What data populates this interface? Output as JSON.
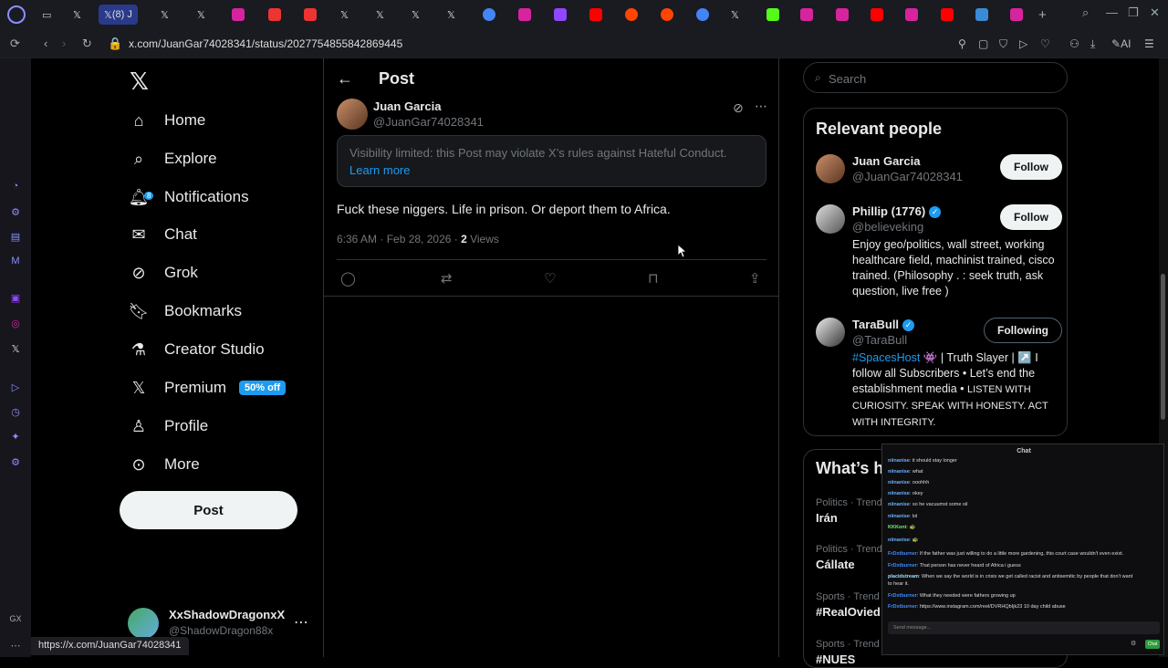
{
  "browser": {
    "url": "x.com/JuanGar74028341/status/2027754855842869445",
    "active_tab_label": "(8) J",
    "status_url": "https://x.com/JuanGar74028341",
    "ai_label": "AI",
    "rail_bottom_label": "GX"
  },
  "sidenav": {
    "items": [
      {
        "label": "Home",
        "icon": "home-icon"
      },
      {
        "label": "Explore",
        "icon": "search-icon"
      },
      {
        "label": "Notifications",
        "icon": "bell-icon"
      },
      {
        "label": "Chat",
        "icon": "mail-icon"
      },
      {
        "label": "Grok",
        "icon": "grok-icon"
      },
      {
        "label": "Bookmarks",
        "icon": "bookmark-icon"
      },
      {
        "label": "Creator Studio",
        "icon": "flask-icon"
      },
      {
        "label": "Premium",
        "icon": "x-icon"
      },
      {
        "label": "Profile",
        "icon": "person-icon"
      },
      {
        "label": "More",
        "icon": "more-circle-icon"
      }
    ],
    "notif_count": "8",
    "premium_badge": "50% off",
    "post_label": "Post",
    "account": {
      "name": "XxShadowDragonxX",
      "handle": "@ShadowDragon88x"
    }
  },
  "main": {
    "title": "Post",
    "author": {
      "name": "Juan Garcia",
      "handle": "@JuanGar74028341"
    },
    "notice": "Visibility limited: this Post may violate X’s rules against Hateful Conduct.",
    "learn_more": "Learn more",
    "tweet_text": "Fuck these niggers. Life in prison. Or deport  them to Africa.",
    "timestamp": "6:36 AM · Feb 28, 2026 · ",
    "views_count": "2",
    "views_label": " Views"
  },
  "right": {
    "search_placeholder": "Search",
    "relevant_title": "Relevant people",
    "people": [
      {
        "name": "Juan Garcia",
        "handle": "@JuanGar74028341",
        "button": "Follow",
        "bio": ""
      },
      {
        "name": "Phillip (1776)",
        "handle": "@believeking",
        "button": "Follow",
        "bio": "Enjoy geo/politics, wall street, working healthcare field, machinist trained, cisco trained. (Philosophy . : seek truth, ask question, live free )"
      },
      {
        "name": "TaraBull",
        "handle": "@TaraBull",
        "button": "Following",
        "bio_tag": "#SpacesHost",
        "bio_rest": " 👾 | Truth Slayer | ↗️ I follow all Subscribers • Let’s end the establishment media • ",
        "bio_caps": "LISTEN WITH CURIOSITY. SPEAK WITH HONESTY. ACT WITH INTEGRITY."
      }
    ],
    "trends_title": "What’s ha",
    "trends": [
      {
        "meta": "Politics · Trend",
        "name": "Irán"
      },
      {
        "meta": "Politics · Trend",
        "name": "Cállate"
      },
      {
        "meta": "Sports · Trend",
        "name": "#RealOvied"
      },
      {
        "meta": "Sports · Trend",
        "name": "#NUES"
      }
    ]
  },
  "chat": {
    "title": "Chat",
    "messages": [
      {
        "user": "niinanise",
        "text": ": it should stay longer",
        "color": "#6ab0ff"
      },
      {
        "user": "niinanise",
        "text": ": what",
        "color": "#6ab0ff"
      },
      {
        "user": "niinanise",
        "text": ": ooohhh",
        "color": "#6ab0ff"
      },
      {
        "user": "niinanise",
        "text": ": okey",
        "color": "#6ab0ff"
      },
      {
        "user": "niinanise",
        "text": ": so he vacuumst some oil",
        "color": "#6ab0ff"
      },
      {
        "user": "niinanise",
        "text": ": lol",
        "color": "#6ab0ff"
      },
      {
        "user": "KKKont",
        "text": ": 🐢",
        "color": "#6ff06f"
      },
      {
        "user": "niinanise",
        "text": ": 🐢",
        "color": "#6ab0ff"
      },
      {
        "user": "FrDxtburner",
        "text": ": If the father was just willing to do a little more gardening, this court case wouldn't even exist.",
        "color": "#3f8cff"
      },
      {
        "user": "FrDxtburner",
        "text": ": That person has never heard of Africa i guess",
        "color": "#3f8cff"
      },
      {
        "user": "placidstream",
        "text": ": When we say the world is in crisis we get called racist and antisemitic by people that don't want",
        "color": "#9be0ff"
      },
      {
        "user": "",
        "text": "to hear it.",
        "color": "#9be0ff"
      },
      {
        "user": "FrDxtburner",
        "text": ": What they needed were fathers growing up",
        "color": "#3f8cff"
      },
      {
        "user": "FrDxtburner",
        "text": ": https://www.instagram.com/reel/DVRHQbIjk23 10 day child abuse",
        "color": "#3f8cff"
      }
    ],
    "input_placeholder": "Send message...",
    "send_label": "Chat"
  },
  "colors": {
    "accent": "#1d9bf0",
    "bg": "#000000",
    "border": "#2f3336",
    "muted": "#71767b"
  }
}
